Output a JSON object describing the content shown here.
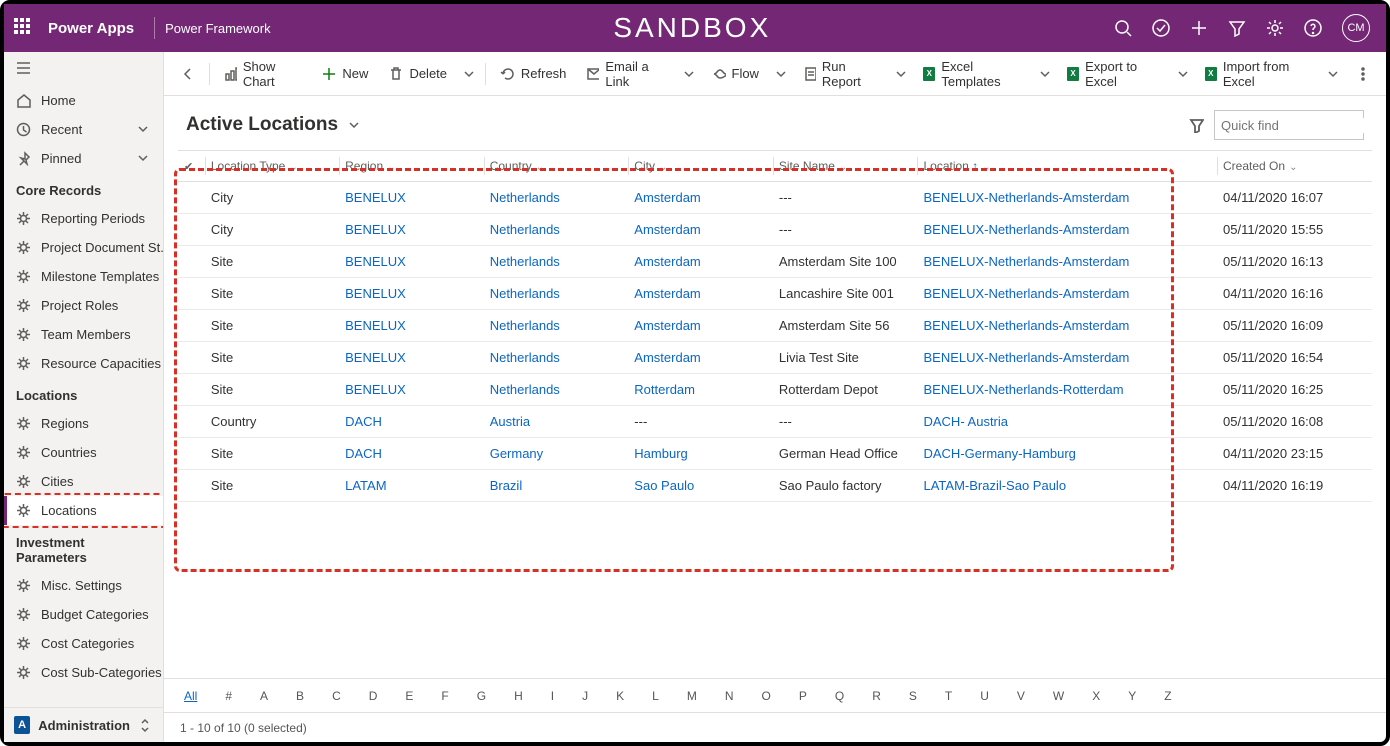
{
  "topbar": {
    "app_name": "Power Apps",
    "sub_name": "Power Framework",
    "env_label": "SANDBOX",
    "avatar_initials": "CM"
  },
  "sidebar": {
    "home": "Home",
    "recent": "Recent",
    "pinned": "Pinned",
    "groups": [
      {
        "label": "Core Records",
        "items": [
          "Reporting Periods",
          "Project Document St...",
          "Milestone Templates",
          "Project Roles",
          "Team Members",
          "Resource Capacities"
        ]
      },
      {
        "label": "Locations",
        "items": [
          "Regions",
          "Countries",
          "Cities",
          "Locations"
        ],
        "selected_index": 3
      },
      {
        "label": "Investment Parameters",
        "items": [
          "Misc. Settings",
          "Budget Categories",
          "Cost Categories",
          "Cost Sub-Categories"
        ]
      }
    ],
    "area": "Administration",
    "area_badge": "A"
  },
  "commandbar": {
    "back": "Back",
    "show_chart": "Show Chart",
    "new": "New",
    "delete": "Delete",
    "refresh": "Refresh",
    "email_link": "Email a Link",
    "flow": "Flow",
    "run_report": "Run Report",
    "excel_templates": "Excel Templates",
    "export_excel": "Export to Excel",
    "import_excel": "Import from Excel"
  },
  "view": {
    "title": "Active Locations",
    "quickfind_placeholder": "Quick find",
    "columns": [
      "Location Type",
      "Region",
      "Country",
      "City",
      "Site Name",
      "Location",
      "Created On"
    ],
    "sort_column": "Location",
    "rows": [
      {
        "type": "City",
        "region": "BENELUX",
        "country": "Netherlands",
        "city": "Amsterdam",
        "site": "---",
        "location": "BENELUX-Netherlands-Amsterdam",
        "created": "04/11/2020 16:07"
      },
      {
        "type": "City",
        "region": "BENELUX",
        "country": "Netherlands",
        "city": "Amsterdam",
        "site": "---",
        "location": "BENELUX-Netherlands-Amsterdam",
        "created": "05/11/2020 15:55"
      },
      {
        "type": "Site",
        "region": "BENELUX",
        "country": "Netherlands",
        "city": "Amsterdam",
        "site": "Amsterdam Site 100",
        "location": "BENELUX-Netherlands-Amsterdam",
        "created": "05/11/2020 16:13"
      },
      {
        "type": "Site",
        "region": "BENELUX",
        "country": "Netherlands",
        "city": "Amsterdam",
        "site": "Lancashire Site 001",
        "location": "BENELUX-Netherlands-Amsterdam",
        "created": "04/11/2020 16:16"
      },
      {
        "type": "Site",
        "region": "BENELUX",
        "country": "Netherlands",
        "city": "Amsterdam",
        "site": "Amsterdam Site 56",
        "location": "BENELUX-Netherlands-Amsterdam",
        "created": "05/11/2020 16:09"
      },
      {
        "type": "Site",
        "region": "BENELUX",
        "country": "Netherlands",
        "city": "Amsterdam",
        "site": "Livia Test Site",
        "location": "BENELUX-Netherlands-Amsterdam",
        "created": "05/11/2020 16:54"
      },
      {
        "type": "Site",
        "region": "BENELUX",
        "country": "Netherlands",
        "city": "Rotterdam",
        "site": "Rotterdam Depot",
        "location": "BENELUX-Netherlands-Rotterdam",
        "created": "05/11/2020 16:25"
      },
      {
        "type": "Country",
        "region": "DACH",
        "country": "Austria",
        "city": "---",
        "site": "---",
        "location": "DACH- Austria",
        "created": "05/11/2020 16:08"
      },
      {
        "type": "Site",
        "region": "DACH",
        "country": "Germany",
        "city": "Hamburg",
        "site": "German Head Office",
        "location": "DACH-Germany-Hamburg",
        "created": "04/11/2020 23:15"
      },
      {
        "type": "Site",
        "region": "LATAM",
        "country": "Brazil",
        "city": "Sao Paulo",
        "site": "Sao Paulo factory",
        "location": "LATAM-Brazil-Sao Paulo",
        "created": "04/11/2020 16:19"
      }
    ],
    "alphabar": [
      "All",
      "#",
      "A",
      "B",
      "C",
      "D",
      "E",
      "F",
      "G",
      "H",
      "I",
      "J",
      "K",
      "L",
      "M",
      "N",
      "O",
      "P",
      "Q",
      "R",
      "S",
      "T",
      "U",
      "V",
      "W",
      "X",
      "Y",
      "Z"
    ],
    "status": "1 - 10 of 10 (0 selected)"
  }
}
